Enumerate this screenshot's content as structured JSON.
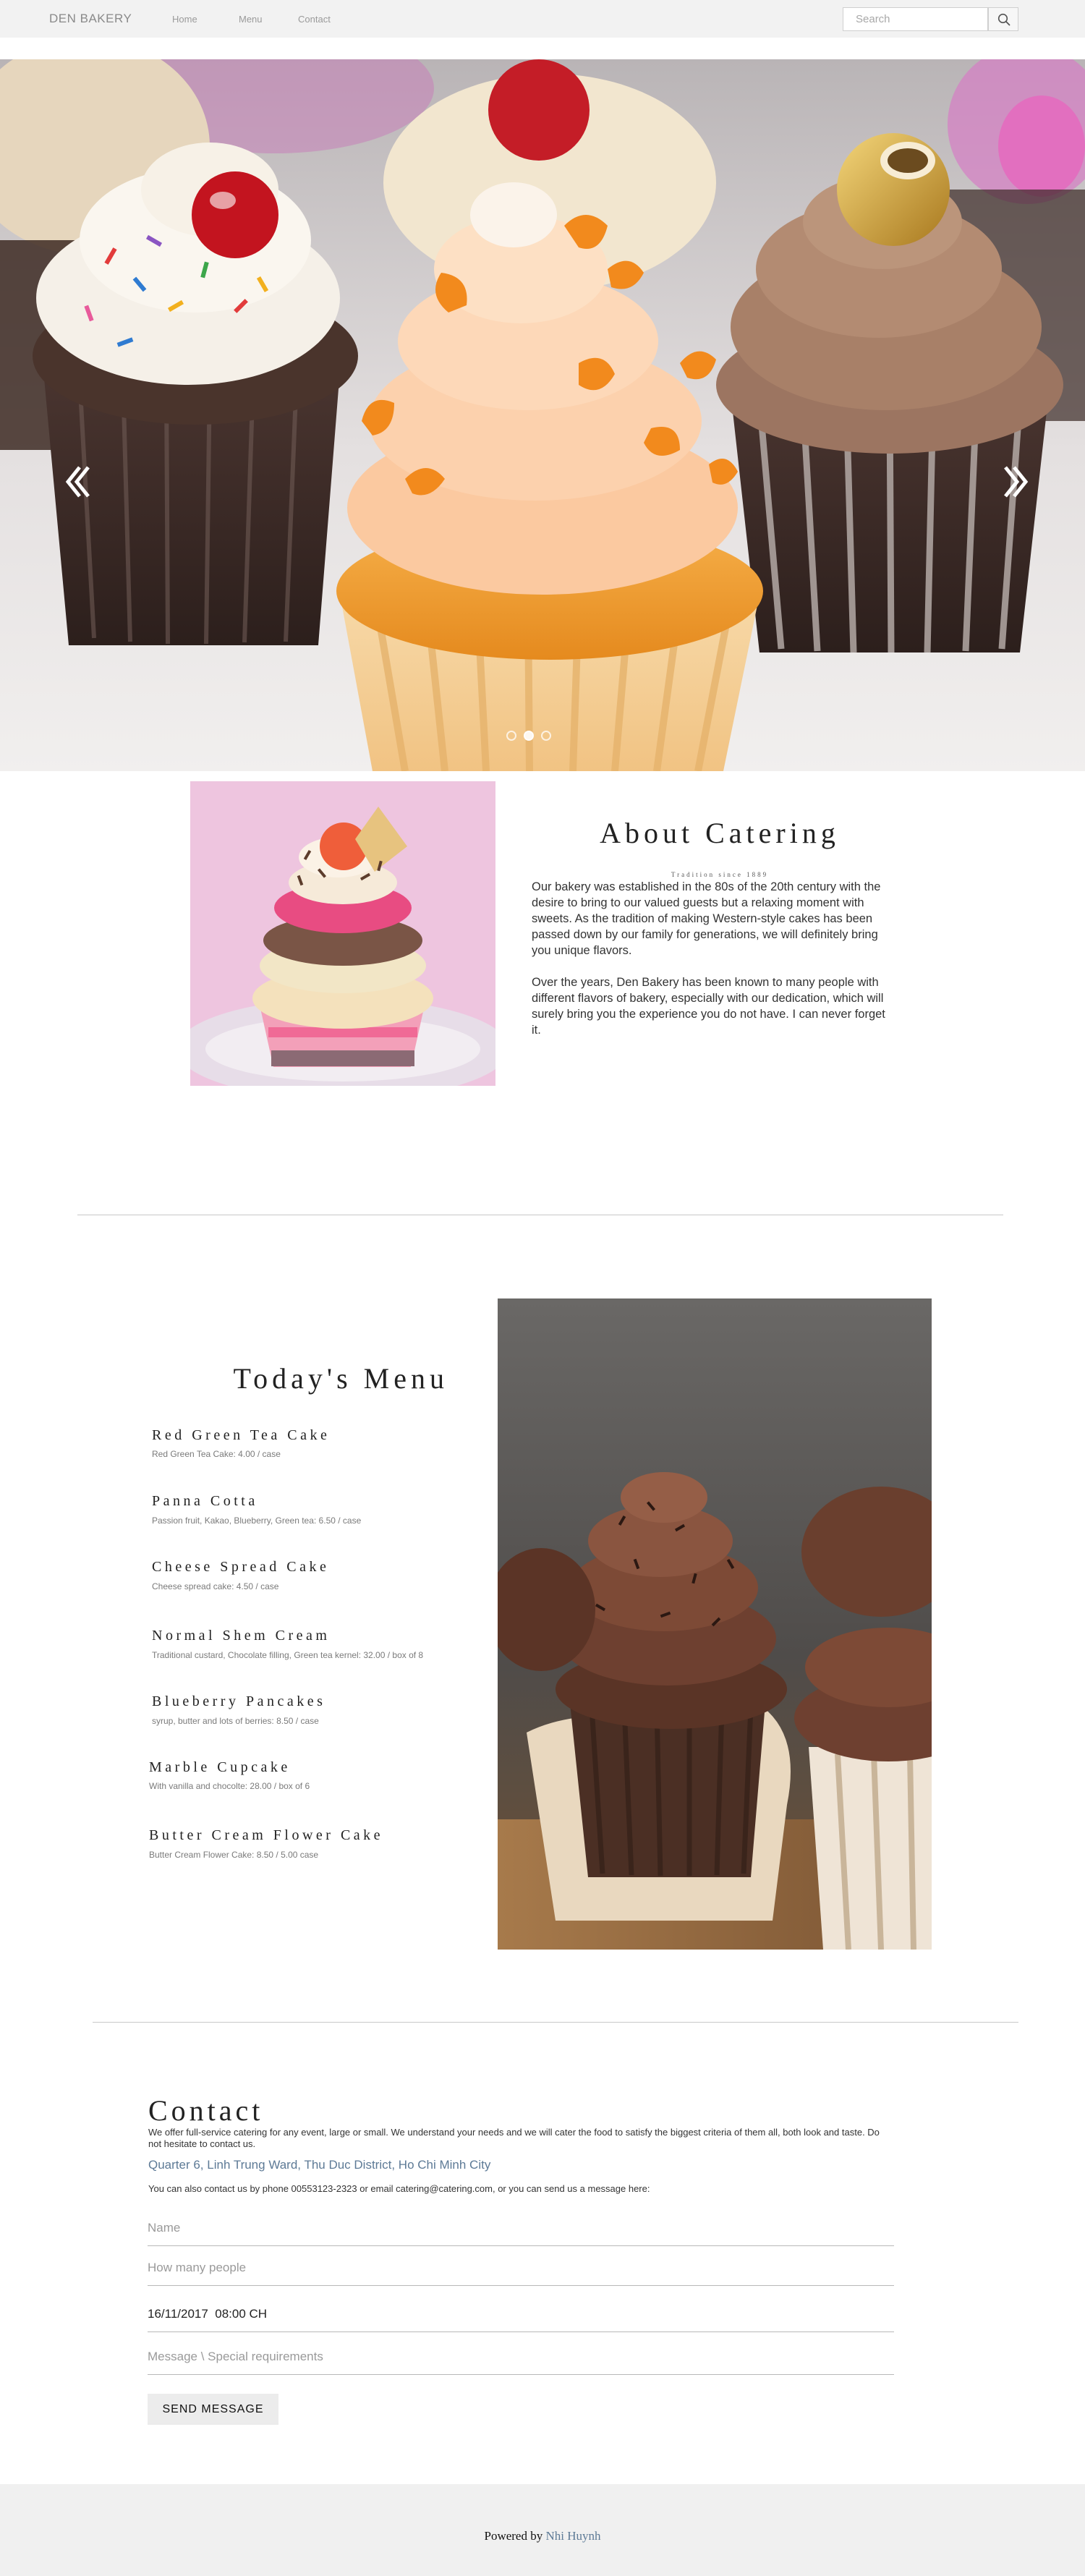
{
  "navbar": {
    "brand": "DEN BAKERY",
    "links": [
      "Home",
      "Menu",
      "Contact"
    ],
    "search_placeholder": "Search",
    "search_icon": "search-icon"
  },
  "hero": {
    "prev_icon": "chevron-double-left-icon",
    "next_icon": "chevron-double-right-icon",
    "slide_count": 3,
    "active_slide": 2
  },
  "about": {
    "title": "About Catering",
    "subtitle": "Tradition since 1889",
    "paragraphs": [
      "Our bakery was established in the 80s of the 20th century with the desire to bring to our valued guests but a relaxing moment with sweets. As the tradition of making Western-style cakes has been passed down by our family for generations, we will definitely bring you unique flavors.",
      "Over the years, Den Bakery has been known to many people with different flavors of bakery, especially with our dedication, which will surely bring you the experience you do not have. I can never forget it."
    ]
  },
  "menu": {
    "title": "Today's Menu",
    "items": [
      {
        "name": "Red Green Tea Cake",
        "desc": "Red Green Tea Cake: 4.00 / case"
      },
      {
        "name": "Panna Cotta",
        "desc": "Passion fruit, Kakao, Blueberry, Green tea: 6.50 / case"
      },
      {
        "name": "Cheese Spread Cake",
        "desc": "Cheese spread cake: 4.50 / case"
      },
      {
        "name": "Normal Shem Cream",
        "desc": "Traditional custard, Chocolate filling, Green tea kernel: 32.00 / box of 8"
      },
      {
        "name": "Blueberry Pancakes",
        "desc": "syrup, butter and lots of berries: 8.50 / case"
      },
      {
        "name": "Marble Cupcake",
        "desc": "With vanilla and chocolte: 28.00 / box of 6"
      },
      {
        "name": "Butter Cream Flower Cake",
        "desc": "Butter Cream Flower Cake: 8.50 / 5.00 case"
      }
    ]
  },
  "contact": {
    "title": "Contact",
    "intro": "We offer full-service catering for any event, large or small. We understand your needs and we will cater the food to satisfy the biggest criteria of them all, both look and taste. Do not hesitate to contact us.",
    "address": "Quarter 6, Linh Trung Ward, Thu Duc District, Ho Chi Minh City",
    "reach": "You can also contact us by phone 00553123-2323 or email catering@catering.com, or you can send us a message here:",
    "fields": {
      "name_placeholder": "Name",
      "people_placeholder": "How many people",
      "datetime_value": "16/11/2017  08:00 CH",
      "message_placeholder": "Message \\ Special requirements"
    },
    "send_label": "SEND MESSAGE"
  },
  "footer": {
    "prefix": "Powered by ",
    "author": "Nhi Huynh",
    "link_color": "#5d7a96"
  }
}
